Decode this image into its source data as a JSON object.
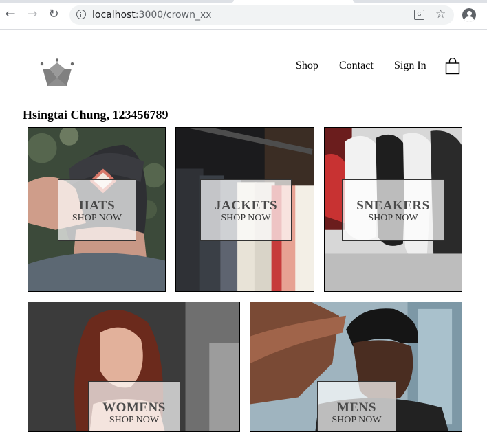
{
  "browser": {
    "url_host": "localhost",
    "url_rest": ":3000/crown_xx"
  },
  "header": {
    "nav": [
      "Shop",
      "Contact",
      "Sign In"
    ],
    "user_title": "Hsingtai Chung, 123456789"
  },
  "directory": [
    {
      "title": "HATS",
      "subtitle": "SHOP NOW"
    },
    {
      "title": "JACKETS",
      "subtitle": "SHOP NOW"
    },
    {
      "title": "SNEAKERS",
      "subtitle": "SHOP NOW"
    },
    {
      "title": "WOMENS",
      "subtitle": "SHOP NOW"
    },
    {
      "title": "MENS",
      "subtitle": "SHOP NOW"
    }
  ]
}
